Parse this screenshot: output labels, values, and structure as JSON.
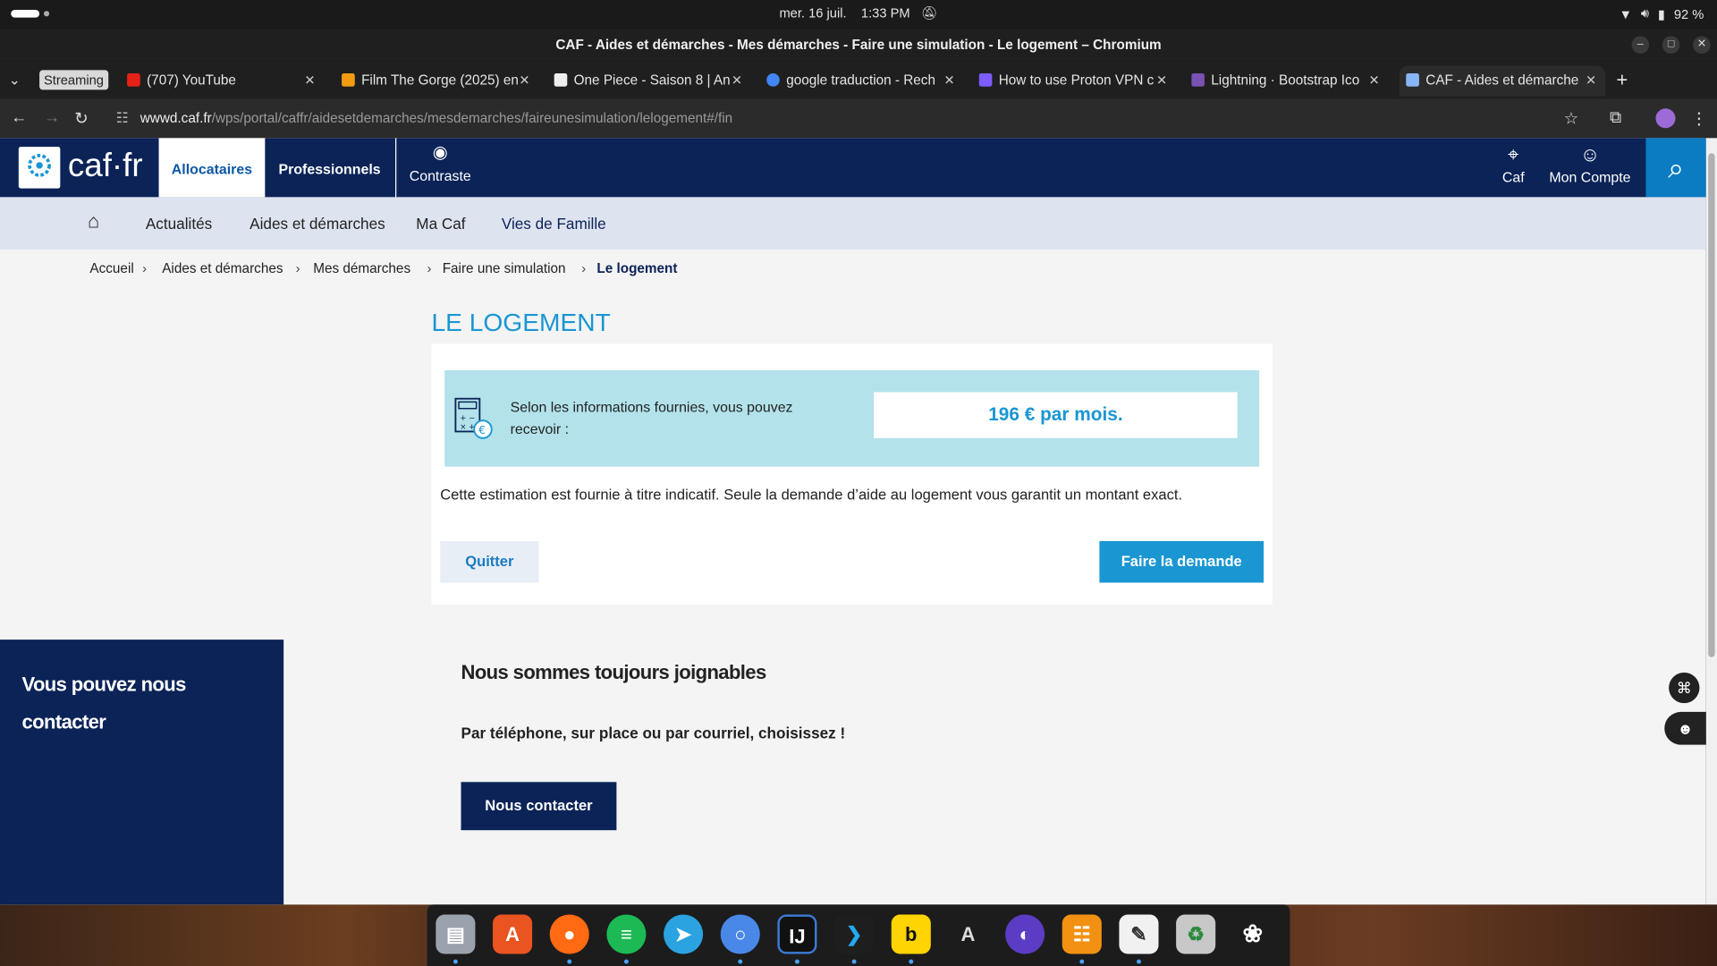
{
  "system": {
    "date": "mer. 16 juil.",
    "time": "1:33 PM",
    "battery": "92 %"
  },
  "window": {
    "title": "CAF - Aides et démarches - Mes démarches - Faire une simulation - Le logement – Chromium"
  },
  "tabs": {
    "group_label": "Streaming",
    "items": [
      {
        "label": "(707) YouTube"
      },
      {
        "label": "Film The Gorge (2025) en"
      },
      {
        "label": "One Piece - Saison 8 | An"
      },
      {
        "label": "google traduction - Rech"
      },
      {
        "label": "How to use Proton VPN c"
      },
      {
        "label": "Lightning · Bootstrap Ico"
      },
      {
        "label": "CAF - Aides et démarche"
      }
    ]
  },
  "address": {
    "host": "wwwd.caf.fr",
    "path": "/wps/portal/caffr/aidesetdemarches/mesdemarches/faireunesimulation/lelogement#/fin"
  },
  "site": {
    "logo": "caf·fr",
    "header": {
      "allocataires": "Allocataires",
      "professionnels": "Professionnels",
      "contraste": "Contraste",
      "caf": "Caf",
      "compte": "Mon Compte"
    },
    "subnav": {
      "actualites": "Actualités",
      "aides": "Aides et démarches",
      "macaf": "Ma Caf",
      "vies": "Vies de Famille"
    },
    "breadcrumb": [
      "Accueil",
      "Aides et démarches",
      "Mes démarches",
      "Faire une simulation",
      "Le logement"
    ],
    "title": "LE LOGEMENT",
    "result": {
      "info": "Selon les informations fournies, vous pouvez recevoir :",
      "amount": "196 € par mois."
    },
    "note": "Cette estimation est fournie à titre indicatif. Seule la demande d’aide au logement vous garantit un montant exact.",
    "buttons": {
      "quit": "Quitter",
      "request": "Faire la demande"
    },
    "contact": {
      "side_title": "Vous pouvez nous contacter",
      "heading": "Nous sommes toujours joignables",
      "subtitle": "Par téléphone, sur place ou par courriel, choisissez !",
      "button": "Nous contacter"
    }
  },
  "colors": {
    "caf_navy": "#0b2357",
    "caf_blue": "#1a96d3",
    "result_band": "#b3e2ea"
  }
}
